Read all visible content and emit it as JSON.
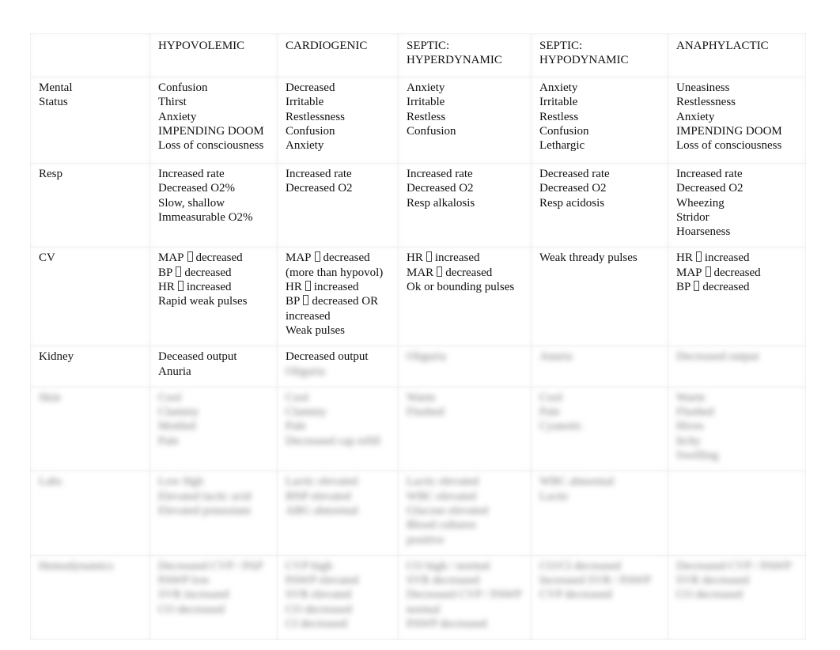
{
  "table": {
    "headers": [
      "",
      "HYPOVOLEMIC",
      "CARDIOGENIC",
      "SEPTIC:\nHYPERDYNAMIC",
      "SEPTIC:\nHYPODYNAMIC",
      "ANAPHYLACTIC"
    ],
    "header_lines": [
      [],
      [
        "HYPOVOLEMIC"
      ],
      [
        "CARDIOGENIC"
      ],
      [
        "SEPTIC:",
        "HYPERDYNAMIC"
      ],
      [
        "SEPTIC:",
        "HYPODYNAMIC"
      ],
      [
        "ANAPHYLACTIC"
      ]
    ],
    "rows": [
      {
        "label_lines": [
          "Mental",
          "Status"
        ],
        "cells": [
          [
            "Confusion",
            "Thirst",
            "Anxiety",
            "IMPENDING DOOM",
            "Loss of consciousness"
          ],
          [
            "Decreased",
            "Irritable",
            "Restlessness",
            "Confusion",
            "Anxiety"
          ],
          [
            "Anxiety",
            "Irritable",
            "Restless",
            "Confusion"
          ],
          [
            "Anxiety",
            "Irritable",
            "Restless",
            "Confusion",
            "Lethargic"
          ],
          [
            "Uneasiness",
            "Restlessness",
            "Anxiety",
            "IMPENDING DOOM",
            "Loss of consciousness"
          ]
        ]
      },
      {
        "label_lines": [
          "Resp"
        ],
        "cells": [
          [
            "Increased rate",
            "Decreased O2%",
            "Slow, shallow",
            "Immeasurable O2%"
          ],
          [
            "Increased rate",
            "Decreased O2"
          ],
          [
            "Increased rate",
            "Decreased O2",
            "Resp alkalosis"
          ],
          [
            "Decreased rate",
            "Decreased O2",
            "Resp acidosis"
          ],
          [
            "Increased rate",
            "Decreased O2",
            "Wheezing",
            "Stridor",
            "Hoarseness"
          ]
        ]
      },
      {
        "label_lines": [
          "CV"
        ],
        "cells": [
          [
            [
              "MAP",
              "decreased"
            ],
            [
              "BP",
              "decreased"
            ],
            [
              "HR",
              "increased"
            ],
            [
              "Rapid weak pulses"
            ]
          ],
          [
            [
              "MAP",
              "decreased"
            ],
            [
              "(more than hypovol)"
            ],
            [
              "HR",
              "increased"
            ],
            [
              "BP",
              "decreased OR"
            ],
            [
              "increased"
            ],
            [
              "Weak pulses"
            ]
          ],
          [
            [
              "HR",
              "increased"
            ],
            [
              "MAR",
              "decreased"
            ],
            [
              "Ok or bounding pulses"
            ]
          ],
          [
            [
              "Weak thready pulses"
            ]
          ],
          [
            [
              "HR",
              "increased"
            ],
            [
              "MAP",
              "decreased"
            ],
            [
              "BP",
              "decreased"
            ]
          ]
        ]
      },
      {
        "label_lines": [
          "Kidney"
        ],
        "cells": [
          [
            "Deceased output",
            "Anuria"
          ],
          [
            "Decreased output",
            "Oliguria"
          ],
          [
            "Oliguria"
          ],
          [
            "Anuria"
          ],
          [
            "Decreased output"
          ]
        ],
        "blurred_from_cell": [
          2,
          1,
          0,
          0,
          0
        ]
      }
    ],
    "blurred_rows": [
      {
        "label_lines": [
          "Skin"
        ],
        "cells": [
          [
            "Cool",
            "Clammy",
            "Mottled",
            "Pale"
          ],
          [
            "Cool",
            "Clammy",
            "Pale",
            "Decreased cap refill"
          ],
          [
            "Warm",
            "Flushed"
          ],
          [
            "Cool",
            "Pale",
            "Cyanotic"
          ],
          [
            "Warm",
            "Flushed",
            "Hives",
            "Itchy",
            "Swelling"
          ]
        ]
      },
      {
        "label_lines": [
          "Labs"
        ],
        "cells": [
          [
            "Low Hgb",
            "Elevated lactic acid",
            "Elevated potassium"
          ],
          [
            "Lactic elevated",
            "BNP elevated",
            "ABG abnormal"
          ],
          [
            "Lactic elevated",
            "WBC elevated",
            "Glucose elevated",
            "Blood cultures",
            "positive"
          ],
          [
            "WBC abnormal",
            "Lactic"
          ],
          []
        ]
      },
      {
        "label_lines": [
          "Hemodynamics"
        ],
        "cells": [
          [
            "Decreased CVP / PAP",
            "PAWP low",
            "SVR increased",
            "CO decreased"
          ],
          [
            "CVP high",
            "PAWP elevated",
            "SVR elevated",
            "CO decreased",
            "CI decreased"
          ],
          [
            "CO high / normal",
            "SVR decreased",
            "Decreased CVP / PAWP",
            "normal",
            "PAWP decreased"
          ],
          [
            "CO/CI decreased",
            "Increased SVR / PAWP",
            "CVP decreased"
          ],
          [
            "Decreased CVP / PAWP",
            "SVR decreased",
            "CO decreased"
          ]
        ]
      }
    ],
    "missing_glyph": "□"
  }
}
